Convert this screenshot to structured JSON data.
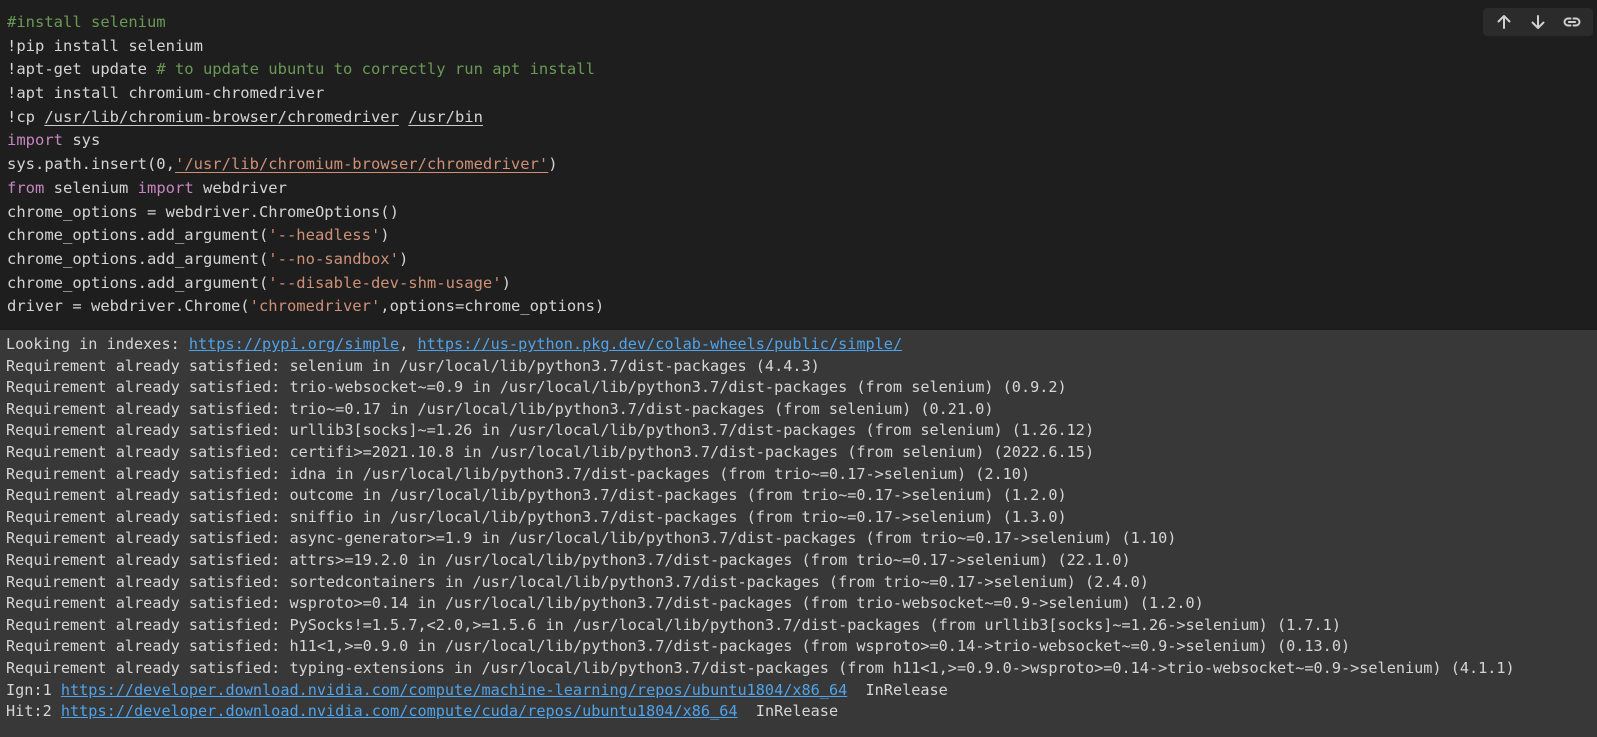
{
  "cell": {
    "code_lines": [
      [
        {
          "t": "#install selenium",
          "c": "comment"
        }
      ],
      [
        {
          "t": "!pip install selenium",
          "c": "plain"
        }
      ],
      [
        {
          "t": "!apt-get update ",
          "c": "plain"
        },
        {
          "t": "# to update ubuntu to correctly run apt install",
          "c": "comment"
        }
      ],
      [
        {
          "t": "!apt install chromium-chromedriver",
          "c": "plain"
        }
      ],
      [
        {
          "t": "!cp ",
          "c": "plain"
        },
        {
          "t": "/usr/lib/chromium-browser/chromedriver",
          "c": "path"
        },
        {
          "t": " ",
          "c": "plain"
        },
        {
          "t": "/usr/bin",
          "c": "path"
        }
      ],
      [
        {
          "t": "import",
          "c": "keyword"
        },
        {
          "t": " sys",
          "c": "plain"
        }
      ],
      [
        {
          "t": "sys.path.insert(0,",
          "c": "plain"
        },
        {
          "t": "'/usr/lib/chromium-browser/chromedriver'",
          "c": "stringpath"
        },
        {
          "t": ")",
          "c": "plain"
        }
      ],
      [
        {
          "t": "from",
          "c": "keyword"
        },
        {
          "t": " selenium ",
          "c": "plain"
        },
        {
          "t": "import",
          "c": "keyword"
        },
        {
          "t": " webdriver",
          "c": "plain"
        }
      ],
      [
        {
          "t": "chrome_options = webdriver.ChromeOptions()",
          "c": "plain"
        }
      ],
      [
        {
          "t": "chrome_options.add_argument(",
          "c": "plain"
        },
        {
          "t": "'--headless'",
          "c": "string"
        },
        {
          "t": ")",
          "c": "plain"
        }
      ],
      [
        {
          "t": "chrome_options.add_argument(",
          "c": "plain"
        },
        {
          "t": "'--no-sandbox'",
          "c": "string"
        },
        {
          "t": ")",
          "c": "plain"
        }
      ],
      [
        {
          "t": "chrome_options.add_argument(",
          "c": "plain"
        },
        {
          "t": "'--disable-dev-shm-usage'",
          "c": "string"
        },
        {
          "t": ")",
          "c": "plain"
        }
      ],
      [
        {
          "t": "driver = webdriver.Chrome(",
          "c": "plain"
        },
        {
          "t": "'chromedriver'",
          "c": "string"
        },
        {
          "t": ",options=chrome_options)",
          "c": "plain"
        }
      ]
    ]
  },
  "toolbar": {
    "buttons": [
      {
        "name": "move-cell-up-button",
        "icon": "arrow-up-icon"
      },
      {
        "name": "move-cell-down-button",
        "icon": "arrow-down-icon"
      },
      {
        "name": "copy-link-button",
        "icon": "link-icon"
      }
    ]
  },
  "output": {
    "lines": [
      [
        {
          "t": "Looking in indexes: "
        },
        {
          "t": "https://pypi.org/simple",
          "link": true
        },
        {
          "t": ", "
        },
        {
          "t": "https://us-python.pkg.dev/colab-wheels/public/simple/",
          "link": true
        }
      ],
      [
        {
          "t": "Requirement already satisfied: selenium in /usr/local/lib/python3.7/dist-packages (4.4.3)"
        }
      ],
      [
        {
          "t": "Requirement already satisfied: trio-websocket~=0.9 in /usr/local/lib/python3.7/dist-packages (from selenium) (0.9.2)"
        }
      ],
      [
        {
          "t": "Requirement already satisfied: trio~=0.17 in /usr/local/lib/python3.7/dist-packages (from selenium) (0.21.0)"
        }
      ],
      [
        {
          "t": "Requirement already satisfied: urllib3[socks]~=1.26 in /usr/local/lib/python3.7/dist-packages (from selenium) (1.26.12)"
        }
      ],
      [
        {
          "t": "Requirement already satisfied: certifi>=2021.10.8 in /usr/local/lib/python3.7/dist-packages (from selenium) (2022.6.15)"
        }
      ],
      [
        {
          "t": "Requirement already satisfied: idna in /usr/local/lib/python3.7/dist-packages (from trio~=0.17->selenium) (2.10)"
        }
      ],
      [
        {
          "t": "Requirement already satisfied: outcome in /usr/local/lib/python3.7/dist-packages (from trio~=0.17->selenium) (1.2.0)"
        }
      ],
      [
        {
          "t": "Requirement already satisfied: sniffio in /usr/local/lib/python3.7/dist-packages (from trio~=0.17->selenium) (1.3.0)"
        }
      ],
      [
        {
          "t": "Requirement already satisfied: async-generator>=1.9 in /usr/local/lib/python3.7/dist-packages (from trio~=0.17->selenium) (1.10)"
        }
      ],
      [
        {
          "t": "Requirement already satisfied: attrs>=19.2.0 in /usr/local/lib/python3.7/dist-packages (from trio~=0.17->selenium) (22.1.0)"
        }
      ],
      [
        {
          "t": "Requirement already satisfied: sortedcontainers in /usr/local/lib/python3.7/dist-packages (from trio~=0.17->selenium) (2.4.0)"
        }
      ],
      [
        {
          "t": "Requirement already satisfied: wsproto>=0.14 in /usr/local/lib/python3.7/dist-packages (from trio-websocket~=0.9->selenium) (1.2.0)"
        }
      ],
      [
        {
          "t": "Requirement already satisfied: PySocks!=1.5.7,<2.0,>=1.5.6 in /usr/local/lib/python3.7/dist-packages (from urllib3[socks]~=1.26->selenium) (1.7.1)"
        }
      ],
      [
        {
          "t": "Requirement already satisfied: h11<1,>=0.9.0 in /usr/local/lib/python3.7/dist-packages (from wsproto>=0.14->trio-websocket~=0.9->selenium) (0.13.0)"
        }
      ],
      [
        {
          "t": "Requirement already satisfied: typing-extensions in /usr/local/lib/python3.7/dist-packages (from h11<1,>=0.9.0->wsproto>=0.14->trio-websocket~=0.9->selenium) (4.1.1)"
        }
      ],
      [
        {
          "t": "Ign:1 "
        },
        {
          "t": "https://developer.download.nvidia.com/compute/machine-learning/repos/ubuntu1804/x86_64",
          "link": true
        },
        {
          "t": "  InRelease"
        }
      ],
      [
        {
          "t": "Hit:2 "
        },
        {
          "t": "https://developer.download.nvidia.com/compute/cuda/repos/ubuntu1804/x86_64",
          "link": true
        },
        {
          "t": "  InRelease"
        }
      ]
    ]
  },
  "colors": {
    "editor_bg": "#1e1e1e",
    "output_bg": "#383838",
    "comment": "#6a9955",
    "keyword": "#c586c0",
    "string": "#ce9178",
    "link": "#4fa3ea"
  }
}
